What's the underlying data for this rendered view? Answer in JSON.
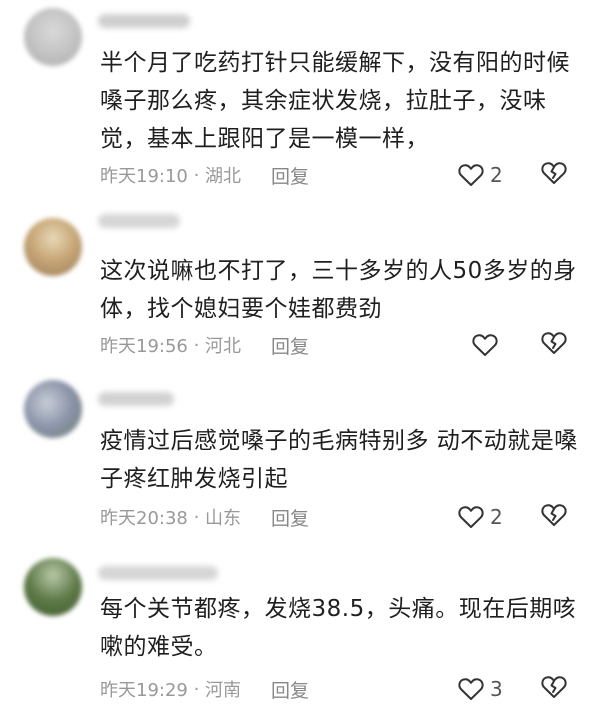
{
  "comments": [
    {
      "text": "半个月了吃药打针只能缓解下，没有阳的时候嗓子那么疼，其余症状发烧，拉肚子，没味觉，基本上跟阳了是一模一样，",
      "time": "昨天19:10",
      "location": "湖北",
      "reply_label": "回复",
      "likes": "2"
    },
    {
      "text": "这次说嘛也不打了，三十多岁的人50多岁的身体，找个媳妇要个娃都费劲",
      "time": "昨天19:56",
      "location": "河北",
      "reply_label": "回复",
      "likes": ""
    },
    {
      "text": "疫情过后感觉嗓子的毛病特别多 动不动就是嗓子疼红肿发烧引起",
      "time": "昨天20:38",
      "location": "山东",
      "reply_label": "回复",
      "likes": "2"
    },
    {
      "text": "每个关节都疼，发烧38.5，头痛。现在后期咳嗽的难受。",
      "time": "昨天19:29",
      "location": "河南",
      "reply_label": "回复",
      "likes": "3"
    }
  ],
  "colors": {
    "meta_text": "#999999",
    "body_text": "#1f1f1f",
    "icon_stroke": "#333333"
  },
  "icons": {
    "like": "heart-icon",
    "dislike": "broken-heart-icon"
  }
}
